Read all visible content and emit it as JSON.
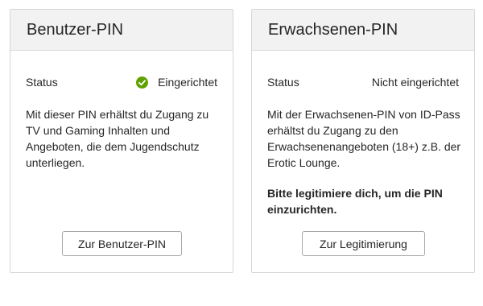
{
  "cards": [
    {
      "title": "Benutzer-PIN",
      "status_label": "Status",
      "status_value": "Eingerichtet",
      "status_icon": "check-circle-icon",
      "status_color": "#5fa200",
      "description": "Mit dieser PIN erhältst du Zugang zu TV und Gaming Inhalten und Angeboten, die dem Jugendschutz unterliegen.",
      "button_label": "Zur Benutzer-PIN"
    },
    {
      "title": "Erwachsenen-PIN",
      "status_label": "Status",
      "status_value": "Nicht eingerichtet",
      "description": "Mit der Erwachsenen-PIN von ID-Pass erhältst du Zugang zu den Erwachsenenangeboten (18+) z.B. der Erotic Lounge.",
      "note": "Bitte legitimiere dich, um die PIN einzurichten.",
      "button_label": "Zur Legitimierung"
    }
  ]
}
